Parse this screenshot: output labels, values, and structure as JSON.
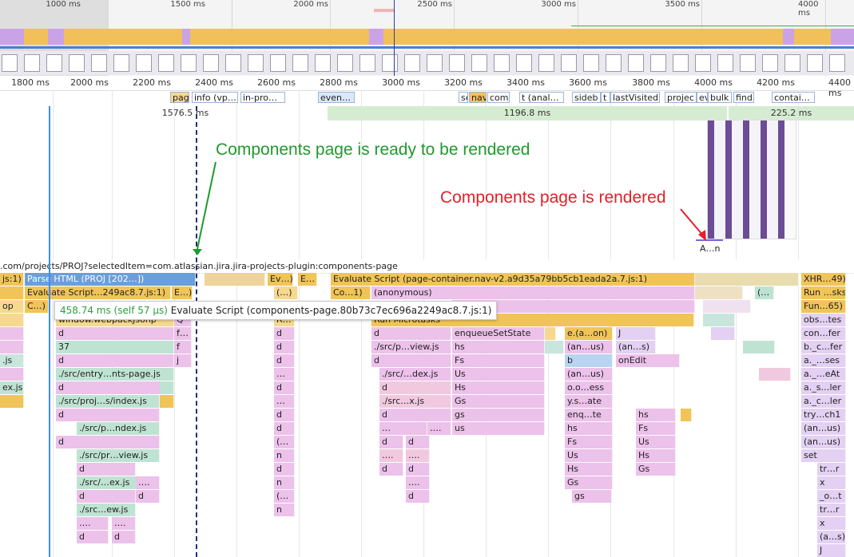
{
  "overview": {
    "ticks": [
      "1000 ms",
      "1500 ms",
      "2000 ms",
      "2500 ms",
      "3000 ms",
      "3500 ms",
      "4000 ms"
    ]
  },
  "ruler": {
    "ticks": [
      "1800 ms",
      "2000 ms",
      "2200 ms",
      "2400 ms",
      "2600 ms",
      "2800 ms",
      "3000 ms",
      "3200 ms",
      "3400 ms",
      "3600 ms",
      "3800 ms",
      "4000 ms",
      "4200 ms",
      "4400 ms"
    ]
  },
  "network": {
    "requests": [
      "pag",
      "info (vp…",
      "in-pro…",
      "even…",
      "se",
      "nav",
      "com",
      "t (anal…",
      "sideb",
      "t (",
      "lastVisited",
      "projec",
      "ev",
      "bulk",
      "find",
      "contai…"
    ]
  },
  "timings": [
    "1576.5 ms",
    "1196.8 ms",
    "225.2 ms"
  ],
  "annotations": {
    "ready": "Components page is ready to be rendered",
    "rendered": "Components page is rendered",
    "ready_color": "#1f9a2e",
    "rendered_color": "#e3202a"
  },
  "screenshot_marker": "A…n",
  "url_row": ".com/projects/PROJ?selectedItem=com.atlassian.jira.jira-projects-plugin:components-page",
  "tooltip": {
    "time": "458.74 ms (self 57 µs)",
    "label": "Evaluate Script (components-page.80b73c7ec696a2249ac8.7.js:1)"
  },
  "flame": {
    "row0": [
      "js:1)",
      "Parse HTML (PROJ [202…])",
      "Ev…)",
      "E…",
      "Evaluate Script (page-container.nav-v2.a9d35a79bb5cb1eada2a.7.js:1)",
      "XHR…49)"
    ],
    "row1": [
      "Evaluate Script…249ac8.7.js:1)",
      "E…)",
      "(…)",
      "Co…1)",
      "(anonymous)",
      "(…",
      "Run …sks"
    ],
    "row2": [
      "op",
      "C…)",
      "onp",
      "Fun…65)"
    ],
    "row3": [
      "window.webpackJsonp",
      "Q",
      "R…",
      "Run Microtasks",
      "obs…tes"
    ],
    "row4": [
      "d",
      "f…",
      "d",
      "d",
      "enqueueSetState",
      "e.(a…on)",
      "J",
      "con…fer"
    ],
    "row5": [
      "37",
      "f",
      "d",
      "./src/p…view.js",
      "hs",
      "(an…us)",
      "(an…s)",
      "b._c…fer"
    ],
    "row6": [
      ".js",
      "d",
      "j",
      "d",
      "d",
      "Fs",
      "b",
      "onEdit",
      "a._…ses"
    ],
    "row7": [
      "./src/entry…nts-page.js",
      "…",
      "./src/…dex.js",
      "Us",
      "(an…us)",
      "a._…eAt"
    ],
    "row8": [
      "ex.js",
      "d",
      "d",
      "d",
      "Hs",
      "o.o…ess",
      "a._s…ler"
    ],
    "row9": [
      "./src/proj…s/index.js",
      "…",
      "./src…x.js",
      "Gs",
      "y.s…ate",
      "a._c…ler"
    ],
    "row10": [
      "d",
      "d",
      "d",
      "gs",
      "enq…te",
      "hs",
      "try…ch1"
    ],
    "row11": [
      "./src/p…ndex.js",
      "d",
      "…",
      "….",
      "us",
      "hs",
      "Fs",
      "(an…us)"
    ],
    "row12": [
      "d",
      "(…",
      "d",
      "d",
      "Fs",
      "Us",
      "(an…us)"
    ],
    "row13": [
      "./src/pr…view.js",
      "n",
      "….",
      "….",
      "Us",
      "Hs",
      "set"
    ],
    "row14": [
      "d",
      "d",
      "d",
      "d",
      "Hs",
      "Gs",
      "tr…r"
    ],
    "row15": [
      "./src/…ex.js",
      "….",
      "n",
      "….",
      "Gs",
      "x"
    ],
    "row16": [
      "d",
      "d",
      "(…",
      "d",
      "gs",
      "_o…t"
    ],
    "row17": [
      "./src…ew.js",
      "n",
      "tr…r"
    ],
    "row18": [
      "….",
      "….",
      "x"
    ],
    "row19": [
      "d",
      "d",
      "(a…s)"
    ],
    "row20": [
      "J"
    ]
  }
}
